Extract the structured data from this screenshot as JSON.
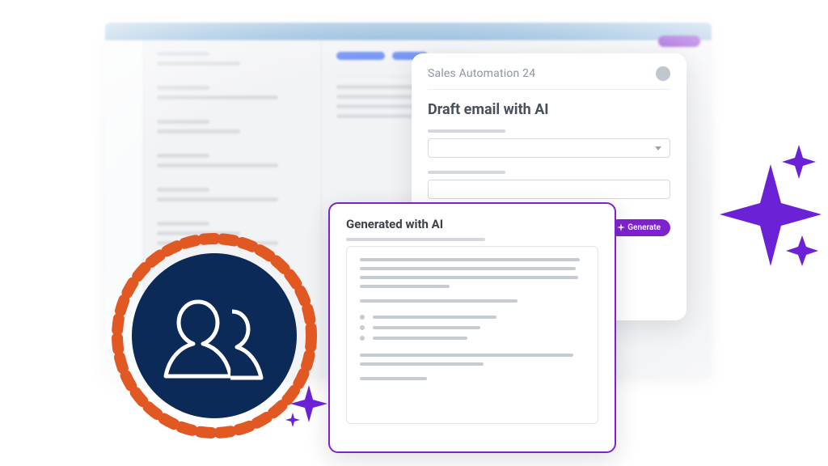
{
  "colors": {
    "accent_purple": "#7e22ce",
    "badge_navy": "#0b2a57",
    "badge_ring": "#e25822"
  },
  "card_a": {
    "title": "Sales Automation 24",
    "heading": "Draft email with AI"
  },
  "card_b": {
    "heading": "Generated with AI"
  },
  "buttons": {
    "generate": "Generate"
  },
  "icons": {
    "avatar_dot": "avatar-placeholder",
    "dropdown": "chevron-down-icon",
    "generate_spark": "spark-icon",
    "sparkle_big": "sparkle-icon",
    "sparkle_small": "sparkle-icon",
    "people_badge": "people-icon"
  }
}
